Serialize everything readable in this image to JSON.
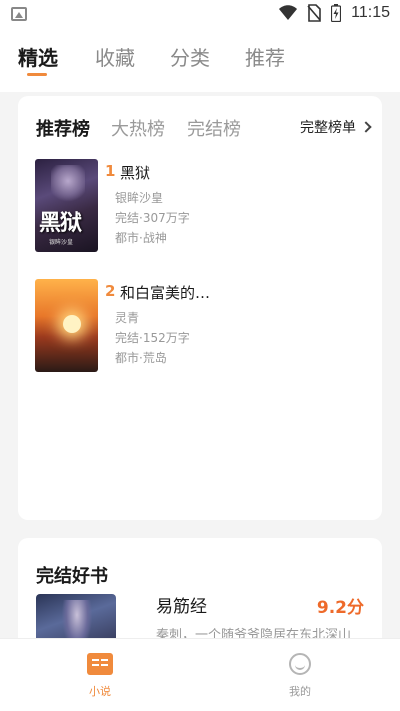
{
  "status_bar": {
    "time": "11:15",
    "icons": [
      "image-icon",
      "wifi-icon",
      "no-sim-icon",
      "battery-charging-icon"
    ]
  },
  "top_tabs": [
    {
      "label": "精选",
      "active": true
    },
    {
      "label": "收藏",
      "active": false
    },
    {
      "label": "分类",
      "active": false
    },
    {
      "label": "推荐",
      "active": false
    }
  ],
  "ranking": {
    "tabs": [
      {
        "label": "推荐榜",
        "active": true
      },
      {
        "label": "大热榜",
        "active": false
      },
      {
        "label": "完结榜",
        "active": false
      }
    ],
    "full_list_label": "完整榜单",
    "books": [
      {
        "rank": "1",
        "title": "黑狱",
        "author": "银眸沙皇",
        "status": "完结·307万字",
        "tags": "都市·战神",
        "cover_text": "黑狱"
      },
      {
        "rank": "2",
        "title": "和白富美的…",
        "author": "灵青",
        "status": "完结·152万字",
        "tags": "都市·荒岛"
      }
    ]
  },
  "finished_section": {
    "title": "完结好书",
    "book": {
      "name": "易筋经",
      "score": "9.2分",
      "desc": "秦刺，一个随爷爷隐居在东北深山"
    }
  },
  "bottom_nav": [
    {
      "label": "小说",
      "active": true,
      "icon": "book-icon"
    },
    {
      "label": "我的",
      "active": false,
      "icon": "profile-icon"
    }
  ],
  "colors": {
    "accent": "#f08a3c",
    "score": "#ee6a2a"
  }
}
